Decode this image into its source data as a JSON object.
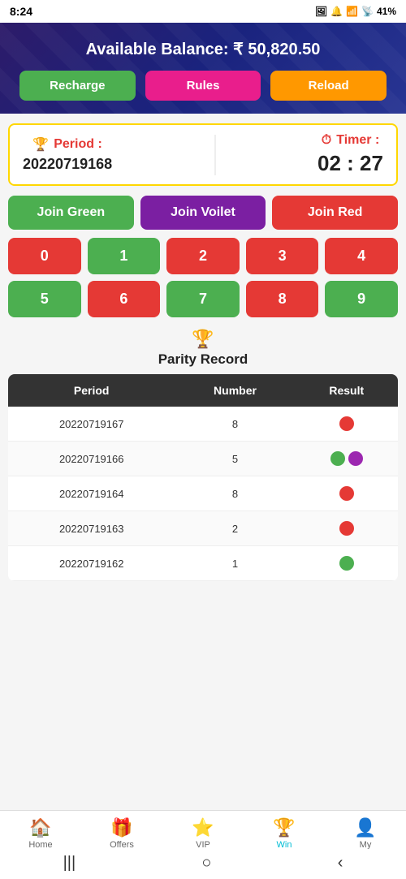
{
  "statusBar": {
    "time": "8:24",
    "battery": "41%"
  },
  "header": {
    "balanceLabel": "Available Balance: ₹ 50,820.50",
    "buttons": {
      "recharge": "Recharge",
      "rules": "Rules",
      "reload": "Reload"
    }
  },
  "period": {
    "label": "Period :",
    "value": "20220719168",
    "timerLabel": "Timer :",
    "timerValue": "02 : 27"
  },
  "joinButtons": {
    "green": "Join Green",
    "violet": "Join Voilet",
    "red": "Join Red"
  },
  "numbers": {
    "row1": [
      "0",
      "1",
      "2",
      "3",
      "4"
    ],
    "row2": [
      "5",
      "6",
      "7",
      "8",
      "9"
    ],
    "colors_row1": [
      "red",
      "green",
      "red",
      "red",
      "red"
    ],
    "colors_row2": [
      "green",
      "red",
      "green",
      "red",
      "green"
    ]
  },
  "parityRecord": {
    "trophy": "🏆",
    "title": "Parity Record",
    "columns": [
      "Period",
      "Number",
      "Result"
    ],
    "rows": [
      {
        "period": "20220719167",
        "number": "8",
        "numColor": "orange",
        "dots": [
          "red"
        ]
      },
      {
        "period": "20220719166",
        "number": "5",
        "numColor": "green",
        "dots": [
          "green",
          "violet"
        ]
      },
      {
        "period": "20220719164",
        "number": "8",
        "numColor": "orange",
        "dots": [
          "red"
        ]
      },
      {
        "period": "20220719163",
        "number": "2",
        "numColor": "red",
        "dots": [
          "red"
        ]
      },
      {
        "period": "20220719162",
        "number": "1",
        "numColor": "green",
        "dots": [
          "green"
        ]
      }
    ]
  },
  "bottomNav": {
    "items": [
      {
        "icon": "🏠",
        "label": "Home",
        "active": false
      },
      {
        "icon": "🎁",
        "label": "Offers",
        "active": false
      },
      {
        "icon": "⭐",
        "label": "VIP",
        "active": false
      },
      {
        "icon": "🏆",
        "label": "Win",
        "active": true
      },
      {
        "icon": "👤",
        "label": "My",
        "active": false
      }
    ]
  }
}
